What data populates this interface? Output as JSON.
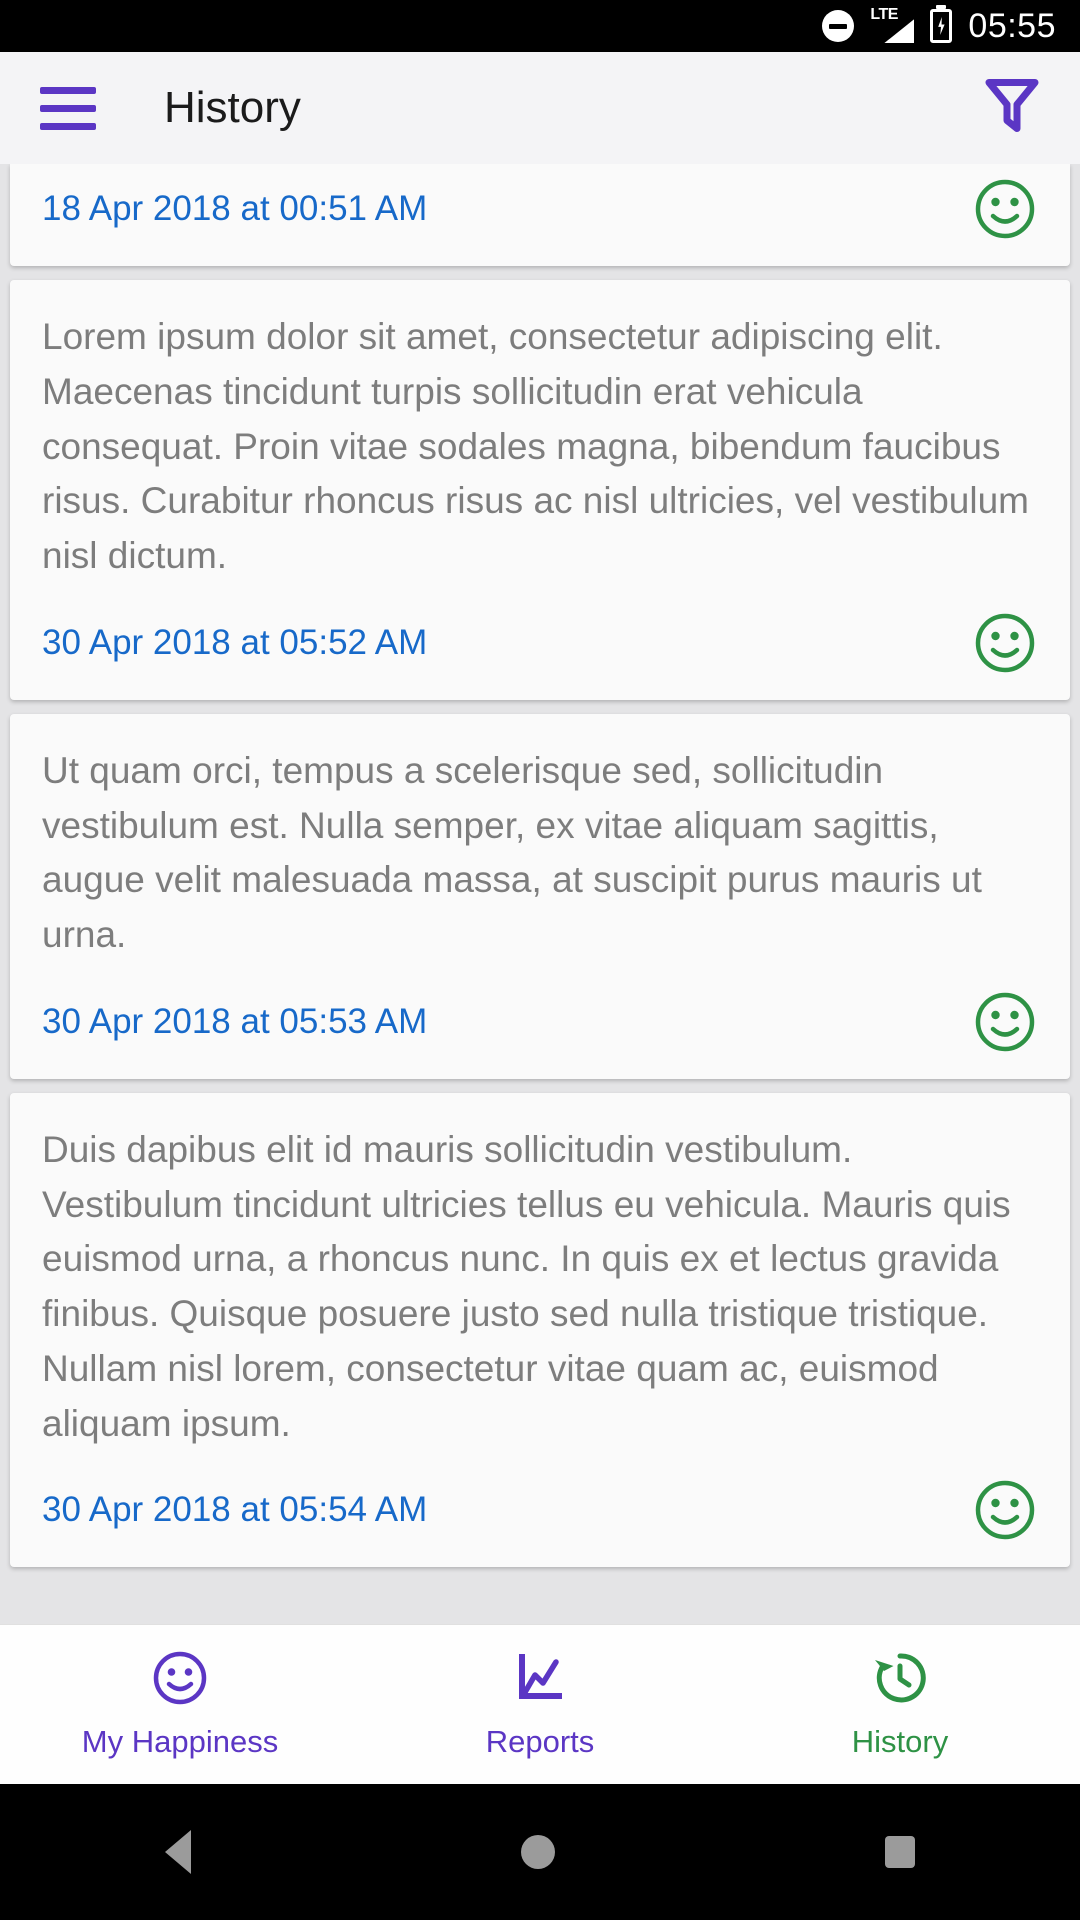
{
  "statusbar": {
    "dnd_icon": "do-not-disturb-icon",
    "network_label": "LTE",
    "signal_icon": "signal-bars-icon",
    "battery_icon": "battery-charging-icon",
    "time": "05:55"
  },
  "appbar": {
    "menu_icon": "hamburger-menu-icon",
    "title": "History",
    "filter_icon": "filter-funnel-icon",
    "accent_color": "#5b36c4",
    "title_color": "#1b1b1b",
    "background": "#f4f4f6"
  },
  "colors": {
    "date_blue": "#1769c9",
    "body_gray": "#7d7d7d",
    "smiley_green": "#2e9245",
    "purple": "#5b36c4",
    "list_background": "#e4e4e6",
    "card_background": "#fafafa"
  },
  "list": {
    "entries": [
      {
        "text": "",
        "date": "18 Apr 2018 at 00:51 AM",
        "mood_icon": "smiley-happy-icon",
        "partial": true
      },
      {
        "text": "Lorem ipsum dolor sit amet, consectetur adipiscing elit. Maecenas tincidunt turpis sollicitudin erat vehicula consequat. Proin vitae sodales magna, bibendum faucibus risus. Curabitur rhoncus risus ac nisl ultricies, vel vestibulum nisl dictum.",
        "date": "30 Apr 2018 at 05:52 AM",
        "mood_icon": "smiley-happy-icon",
        "partial": false
      },
      {
        "text": "Ut quam orci, tempus a scelerisque sed, sollicitudin vestibulum est. Nulla semper, ex vitae aliquam sagittis, augue velit malesuada massa, at suscipit purus mauris ut urna.",
        "date": "30 Apr 2018 at 05:53 AM",
        "mood_icon": "smiley-happy-icon",
        "partial": false
      },
      {
        "text": "Duis dapibus elit id mauris sollicitudin vestibulum. Vestibulum tincidunt ultricies tellus eu vehicula. Mauris quis euismod urna, a rhoncus nunc. In quis ex et lectus gravida finibus. Quisque posuere justo sed nulla tristique tristique. Nullam nisl lorem, consectetur vitae quam ac, euismod aliquam ipsum.",
        "date": "30 Apr 2018 at 05:54 AM",
        "mood_icon": "smiley-happy-icon",
        "partial": false
      }
    ]
  },
  "bottomnav": {
    "items": [
      {
        "label": "My Happiness",
        "icon": "smiley-face-icon",
        "active": false,
        "color": "#5b36c4"
      },
      {
        "label": "Reports",
        "icon": "line-chart-icon",
        "active": false,
        "color": "#5b36c4"
      },
      {
        "label": "History",
        "icon": "history-clock-icon",
        "active": true,
        "color": "#2e9245"
      }
    ]
  },
  "androidnav": {
    "back_icon": "back-triangle-icon",
    "home_icon": "home-circle-icon",
    "recents_icon": "recents-square-icon"
  }
}
